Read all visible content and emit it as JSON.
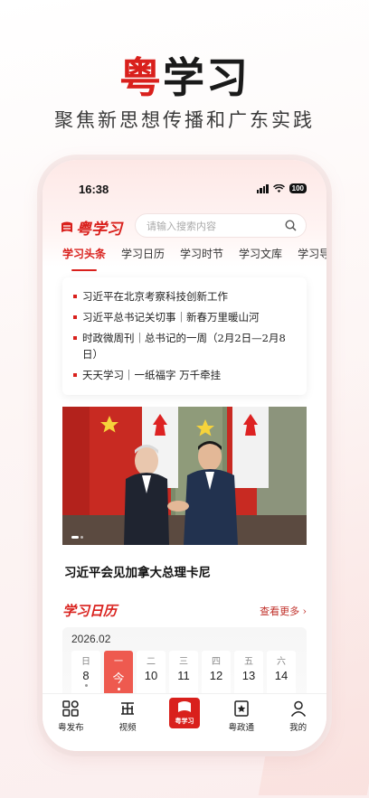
{
  "promo": {
    "title_red": "粤",
    "title_rest": "学习",
    "subtitle": "聚焦新思想传播和广东实践"
  },
  "status_bar": {
    "time": "16:38",
    "battery": "100"
  },
  "header": {
    "logo_text": "粤学习",
    "search_placeholder": "请输入搜索内容"
  },
  "tabs": [
    {
      "label": "学习头条",
      "active": true
    },
    {
      "label": "学习日历"
    },
    {
      "label": "学习时节"
    },
    {
      "label": "学习文库"
    },
    {
      "label": "学习导读"
    }
  ],
  "news": [
    "习近平在北京考察科技创新工作",
    "习近平总书记关切事｜新春万里暖山河",
    "时政微周刊｜总书记的一周（2月2日—2月8日）",
    "天天学习｜一纸福字 万千牵挂"
  ],
  "photo_caption": "习近平会见加拿大总理卡尼",
  "calendar": {
    "logo": "学习日历",
    "more": "查看更多 ›",
    "month": "2026.02",
    "days": [
      {
        "week": "日",
        "date": "8"
      },
      {
        "week": "一",
        "date": "今",
        "today": true
      },
      {
        "week": "二",
        "date": "10"
      },
      {
        "week": "三",
        "date": "11"
      },
      {
        "week": "四",
        "date": "12"
      },
      {
        "week": "五",
        "date": "13"
      },
      {
        "week": "六",
        "date": "14"
      }
    ]
  },
  "bottom_nav": [
    {
      "label": "粤发布",
      "icon": "grid-icon"
    },
    {
      "label": "视频",
      "icon": "video-icon"
    },
    {
      "label": "粤学习",
      "icon": "app-logo-icon"
    },
    {
      "label": "粤政通",
      "icon": "star-badge-icon"
    },
    {
      "label": "我的",
      "icon": "user-icon"
    }
  ],
  "colors": {
    "accent": "#d9201c",
    "today": "#ee5a4f"
  }
}
